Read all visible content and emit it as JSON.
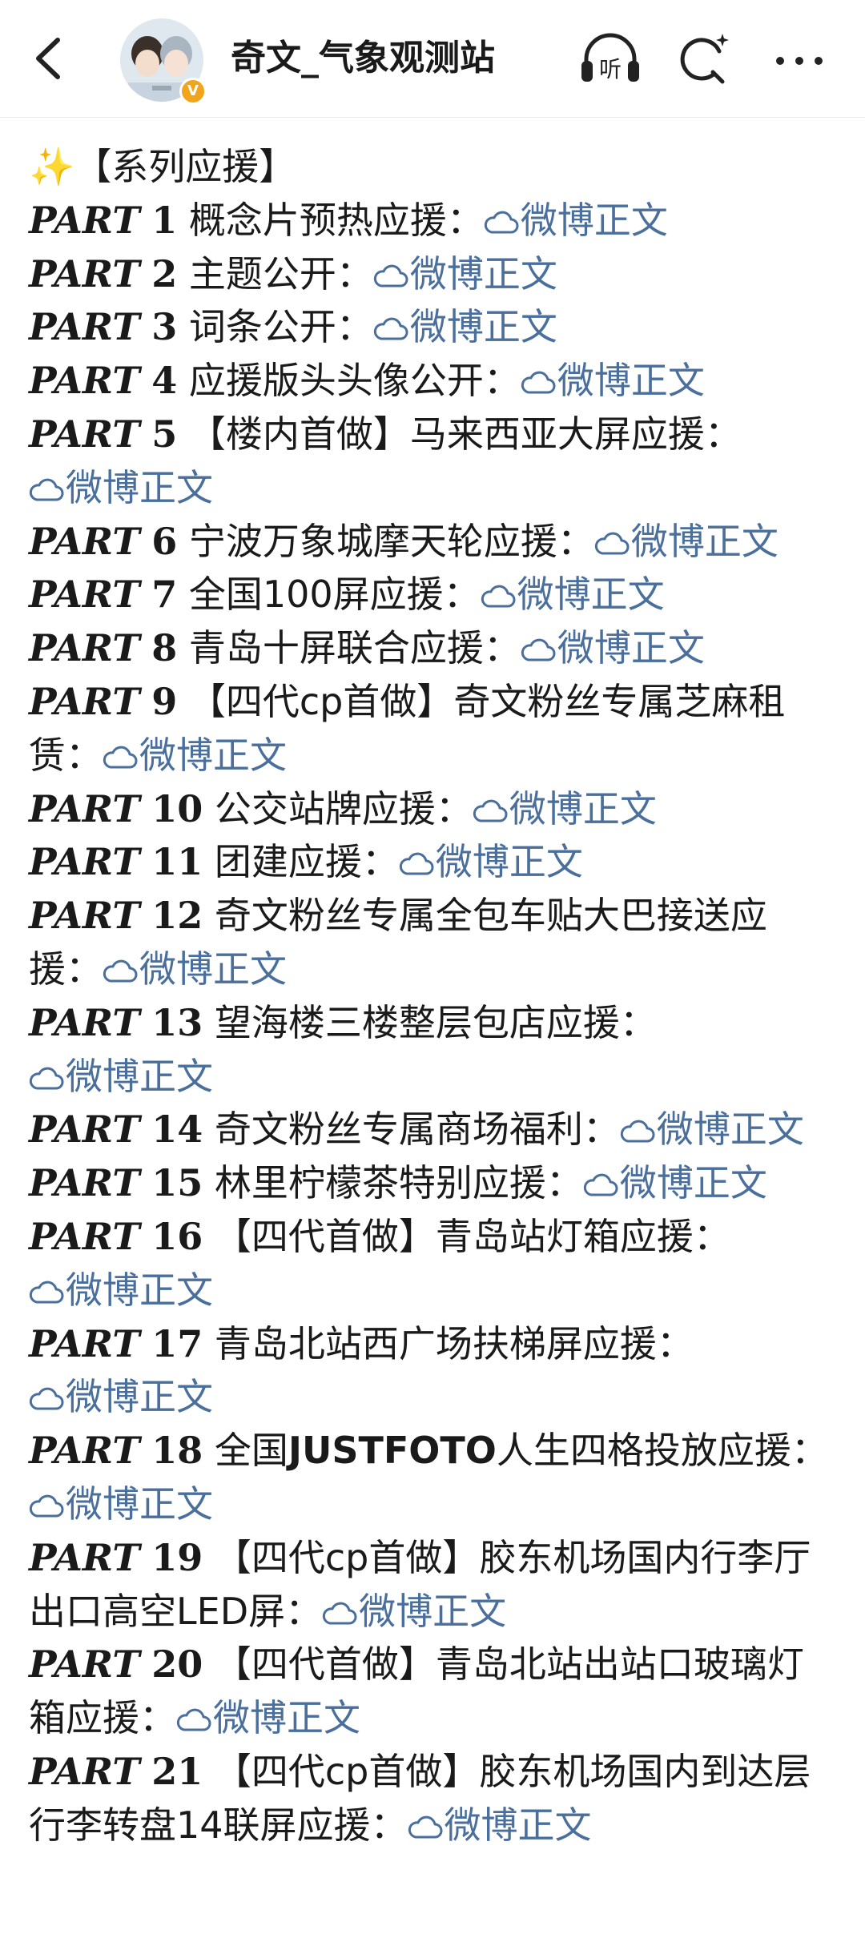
{
  "header": {
    "username": "奇文_气象观测站",
    "verified_badge": "V",
    "icons": [
      "back-arrow-icon",
      "listen-icon",
      "search-icon",
      "more-icon"
    ],
    "listen_label": "听"
  },
  "post": {
    "intro_emoji": "✨",
    "intro": "【系列应援】",
    "link_text": "微博正文",
    "link_color": "#4a6f9c",
    "parts": [
      {
        "label": "PART",
        "num": "1",
        "pre": "概念片预热应援："
      },
      {
        "label": "PART",
        "num": "2",
        "pre": "主题公开："
      },
      {
        "label": "PART",
        "num": "3",
        "pre": "词条公开："
      },
      {
        "label": "PART",
        "num": "4",
        "pre": "应援版头头像公开："
      },
      {
        "label": "PART",
        "num": "5",
        "pre": "【楼内首做】马来西亚大屏应援："
      },
      {
        "label": "PART",
        "num": "6",
        "pre": "宁波万象城摩天轮应援："
      },
      {
        "label": "PART",
        "num": "7",
        "pre": "全国100屏应援："
      },
      {
        "label": "PART",
        "num": "8",
        "pre": "青岛十屏联合应援："
      },
      {
        "label": "PART",
        "num": "9",
        "pre": "【四代cp首做】奇文粉丝专属芝麻租赁："
      },
      {
        "label": "PART",
        "num": "10",
        "pre": "公交站牌应援："
      },
      {
        "label": "PART",
        "num": "11",
        "pre": "团建应援："
      },
      {
        "label": "PART",
        "num": "12",
        "pre": "奇文粉丝专属全包车贴大巴接送应援："
      },
      {
        "label": "PART",
        "num": "13",
        "pre": "望海楼三楼整层包店应援："
      },
      {
        "label": "PART",
        "num": "14",
        "pre": "奇文粉丝专属商场福利："
      },
      {
        "label": "PART",
        "num": "15",
        "pre": "林里柠檬茶特别应援："
      },
      {
        "label": "PART",
        "num": "16",
        "pre": "【四代首做】青岛站灯箱应援："
      },
      {
        "label": "PART",
        "num": "17",
        "pre": "青岛北站西广场扶梯屏应援："
      },
      {
        "label": "PART",
        "num": "18",
        "pre": "全国",
        "bold_word": "JUSTFOTO",
        "post": "人生四格投放应援："
      },
      {
        "label": "PART",
        "num": "19",
        "pre": "【四代cp首做】胶东机场国内行李厅出口高空LED屏："
      },
      {
        "label": "PART",
        "num": "20",
        "pre": "【四代首做】青岛北站出站口玻璃灯箱应援："
      },
      {
        "label": "PART",
        "num": "21",
        "pre": "【四代cp首做】胶东机场国内到达层行李转盘14联屏应援："
      }
    ]
  }
}
